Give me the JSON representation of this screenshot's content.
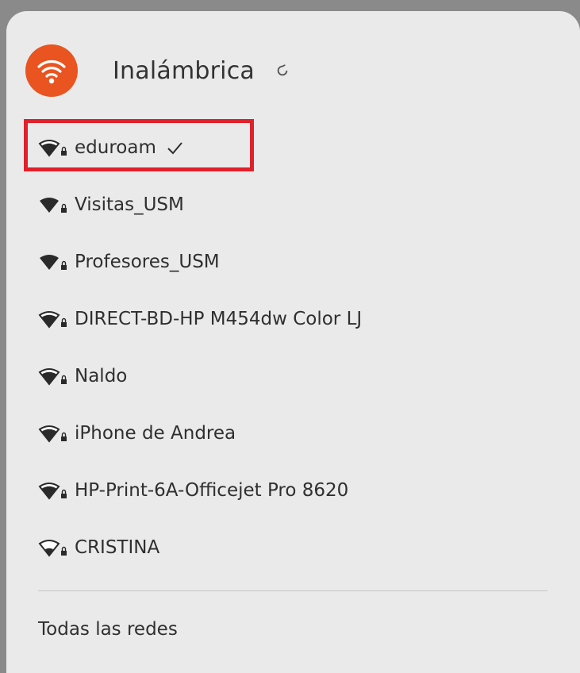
{
  "header": {
    "title": "Inalámbrica",
    "icon": "wifi-icon",
    "spinner_icon": "refresh-spinner-icon",
    "accent": "#e95420"
  },
  "networks": [
    {
      "name": "eduroam",
      "connected": true,
      "signal": "strong"
    },
    {
      "name": "Visitas_USM",
      "connected": false,
      "signal": "full"
    },
    {
      "name": "Profesores_USM",
      "connected": false,
      "signal": "full"
    },
    {
      "name": "DIRECT-BD-HP M454dw Color LJ",
      "connected": false,
      "signal": "strong"
    },
    {
      "name": "Naldo",
      "connected": false,
      "signal": "strong"
    },
    {
      "name": "iPhone de Andrea",
      "connected": false,
      "signal": "strong"
    },
    {
      "name": "HP-Print-6A-Officejet Pro 8620",
      "connected": false,
      "signal": "strong"
    },
    {
      "name": "CRISTINA",
      "connected": false,
      "signal": "weak"
    }
  ],
  "footer": {
    "all_networks_label": "Todas las redes"
  },
  "highlight_color": "#e0202a"
}
